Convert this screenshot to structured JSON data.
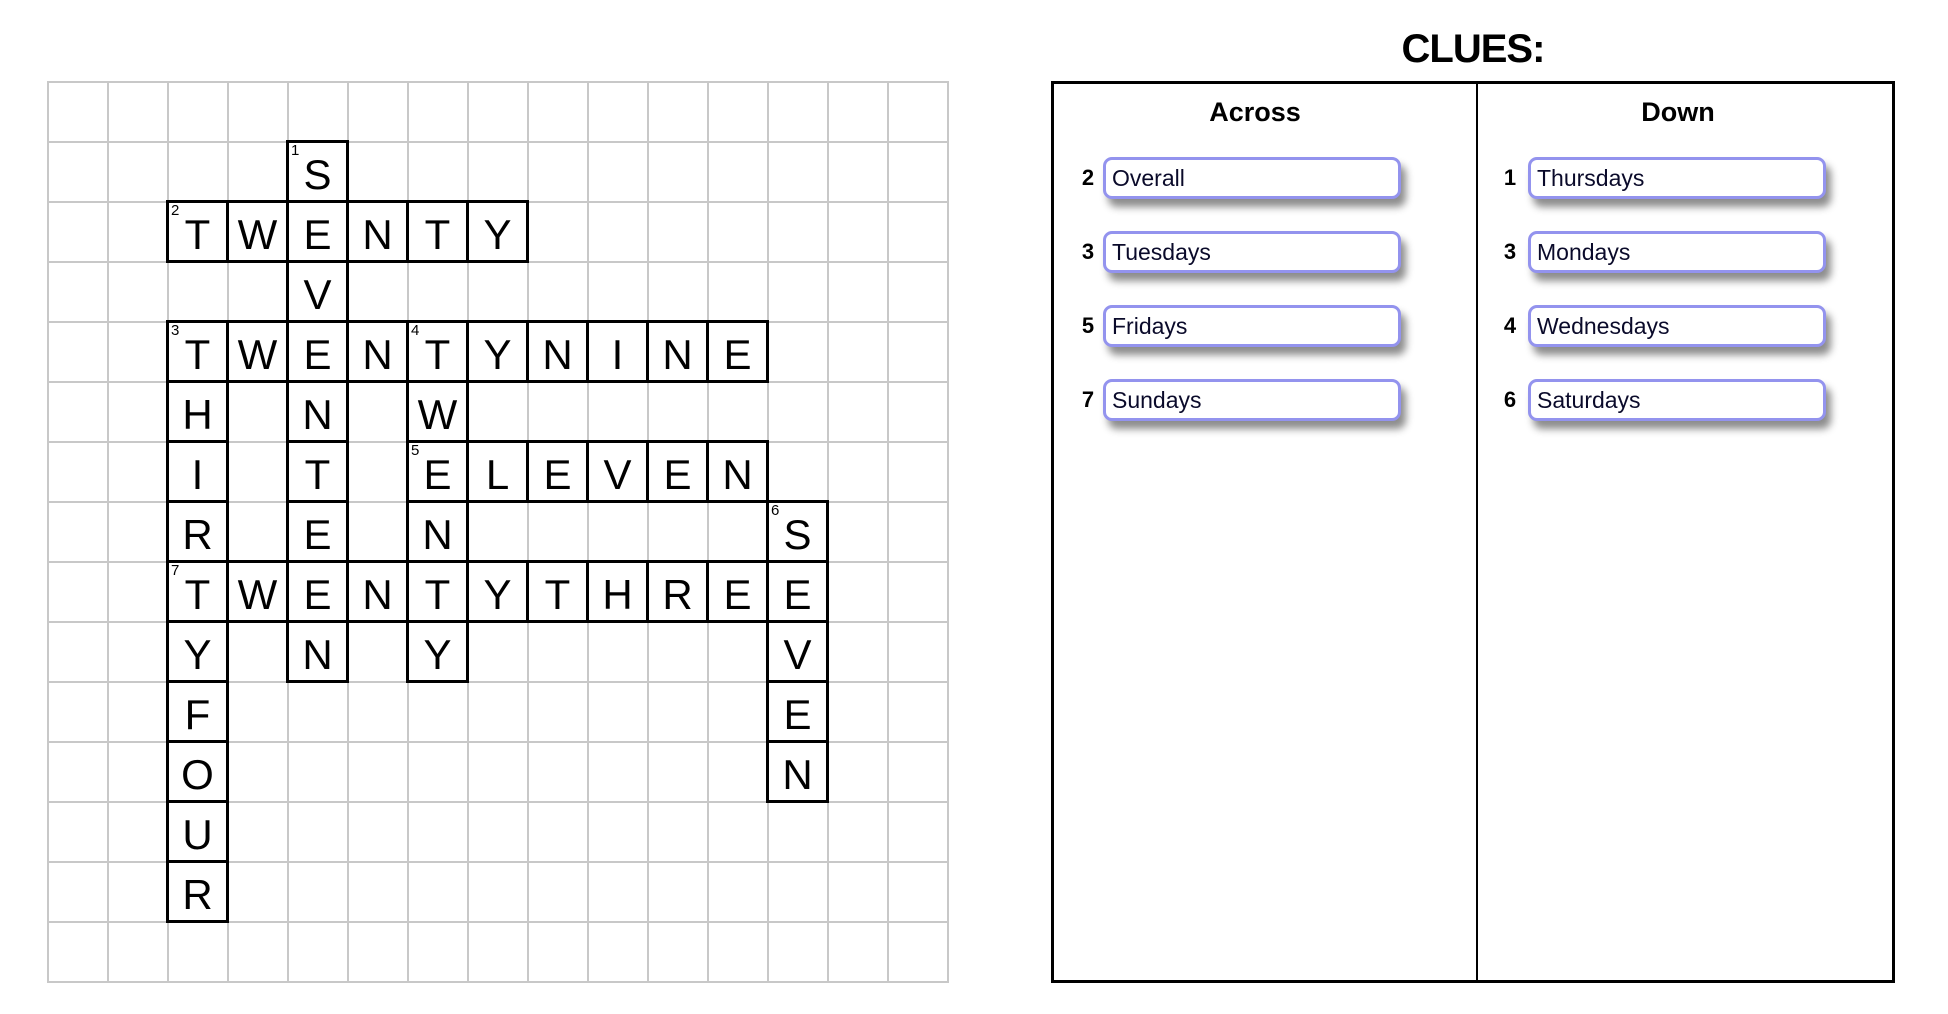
{
  "puzzle": {
    "rows": 15,
    "cols": 15,
    "cells": [
      {
        "r": 1,
        "c": 4,
        "ch": "S",
        "num": "1"
      },
      {
        "r": 2,
        "c": 2,
        "ch": "T",
        "num": "2"
      },
      {
        "r": 2,
        "c": 3,
        "ch": "W"
      },
      {
        "r": 2,
        "c": 4,
        "ch": "E"
      },
      {
        "r": 2,
        "c": 5,
        "ch": "N"
      },
      {
        "r": 2,
        "c": 6,
        "ch": "T"
      },
      {
        "r": 2,
        "c": 7,
        "ch": "Y"
      },
      {
        "r": 3,
        "c": 4,
        "ch": "V"
      },
      {
        "r": 4,
        "c": 2,
        "ch": "T",
        "num": "3"
      },
      {
        "r": 4,
        "c": 3,
        "ch": "W"
      },
      {
        "r": 4,
        "c": 4,
        "ch": "E"
      },
      {
        "r": 4,
        "c": 5,
        "ch": "N"
      },
      {
        "r": 4,
        "c": 6,
        "ch": "T",
        "num": "4"
      },
      {
        "r": 4,
        "c": 7,
        "ch": "Y"
      },
      {
        "r": 4,
        "c": 8,
        "ch": "N"
      },
      {
        "r": 4,
        "c": 9,
        "ch": "I"
      },
      {
        "r": 4,
        "c": 10,
        "ch": "N"
      },
      {
        "r": 4,
        "c": 11,
        "ch": "E"
      },
      {
        "r": 5,
        "c": 2,
        "ch": "H"
      },
      {
        "r": 5,
        "c": 4,
        "ch": "N"
      },
      {
        "r": 5,
        "c": 6,
        "ch": "W"
      },
      {
        "r": 6,
        "c": 2,
        "ch": "I"
      },
      {
        "r": 6,
        "c": 4,
        "ch": "T"
      },
      {
        "r": 6,
        "c": 6,
        "ch": "E",
        "num": "5"
      },
      {
        "r": 6,
        "c": 7,
        "ch": "L"
      },
      {
        "r": 6,
        "c": 8,
        "ch": "E"
      },
      {
        "r": 6,
        "c": 9,
        "ch": "V"
      },
      {
        "r": 6,
        "c": 10,
        "ch": "E"
      },
      {
        "r": 6,
        "c": 11,
        "ch": "N"
      },
      {
        "r": 7,
        "c": 2,
        "ch": "R"
      },
      {
        "r": 7,
        "c": 4,
        "ch": "E"
      },
      {
        "r": 7,
        "c": 6,
        "ch": "N"
      },
      {
        "r": 7,
        "c": 12,
        "ch": "S",
        "num": "6"
      },
      {
        "r": 8,
        "c": 2,
        "ch": "T",
        "num": "7"
      },
      {
        "r": 8,
        "c": 3,
        "ch": "W"
      },
      {
        "r": 8,
        "c": 4,
        "ch": "E"
      },
      {
        "r": 8,
        "c": 5,
        "ch": "N"
      },
      {
        "r": 8,
        "c": 6,
        "ch": "T"
      },
      {
        "r": 8,
        "c": 7,
        "ch": "Y"
      },
      {
        "r": 8,
        "c": 8,
        "ch": "T"
      },
      {
        "r": 8,
        "c": 9,
        "ch": "H"
      },
      {
        "r": 8,
        "c": 10,
        "ch": "R"
      },
      {
        "r": 8,
        "c": 11,
        "ch": "E"
      },
      {
        "r": 8,
        "c": 12,
        "ch": "E"
      },
      {
        "r": 9,
        "c": 2,
        "ch": "Y"
      },
      {
        "r": 9,
        "c": 4,
        "ch": "N"
      },
      {
        "r": 9,
        "c": 6,
        "ch": "Y"
      },
      {
        "r": 9,
        "c": 12,
        "ch": "V"
      },
      {
        "r": 10,
        "c": 2,
        "ch": "F"
      },
      {
        "r": 10,
        "c": 12,
        "ch": "E"
      },
      {
        "r": 11,
        "c": 2,
        "ch": "O"
      },
      {
        "r": 11,
        "c": 12,
        "ch": "N"
      },
      {
        "r": 12,
        "c": 2,
        "ch": "U"
      },
      {
        "r": 13,
        "c": 2,
        "ch": "R"
      }
    ]
  },
  "clues": {
    "title": "CLUES:",
    "across": {
      "heading": "Across",
      "items": [
        {
          "num": "2",
          "value": "Overall"
        },
        {
          "num": "3",
          "value": "Tuesdays"
        },
        {
          "num": "5",
          "value": "Fridays"
        },
        {
          "num": "7",
          "value": "Sundays"
        }
      ]
    },
    "down": {
      "heading": "Down",
      "items": [
        {
          "num": "1",
          "value": "Thursdays"
        },
        {
          "num": "3",
          "value": "Mondays"
        },
        {
          "num": "4",
          "value": "Wednesdays"
        },
        {
          "num": "6",
          "value": "Saturdays"
        }
      ]
    }
  },
  "colors": {
    "grid_line": "#c8c8c8",
    "word_border": "#000000",
    "clue_box_border": "#9393ee"
  }
}
